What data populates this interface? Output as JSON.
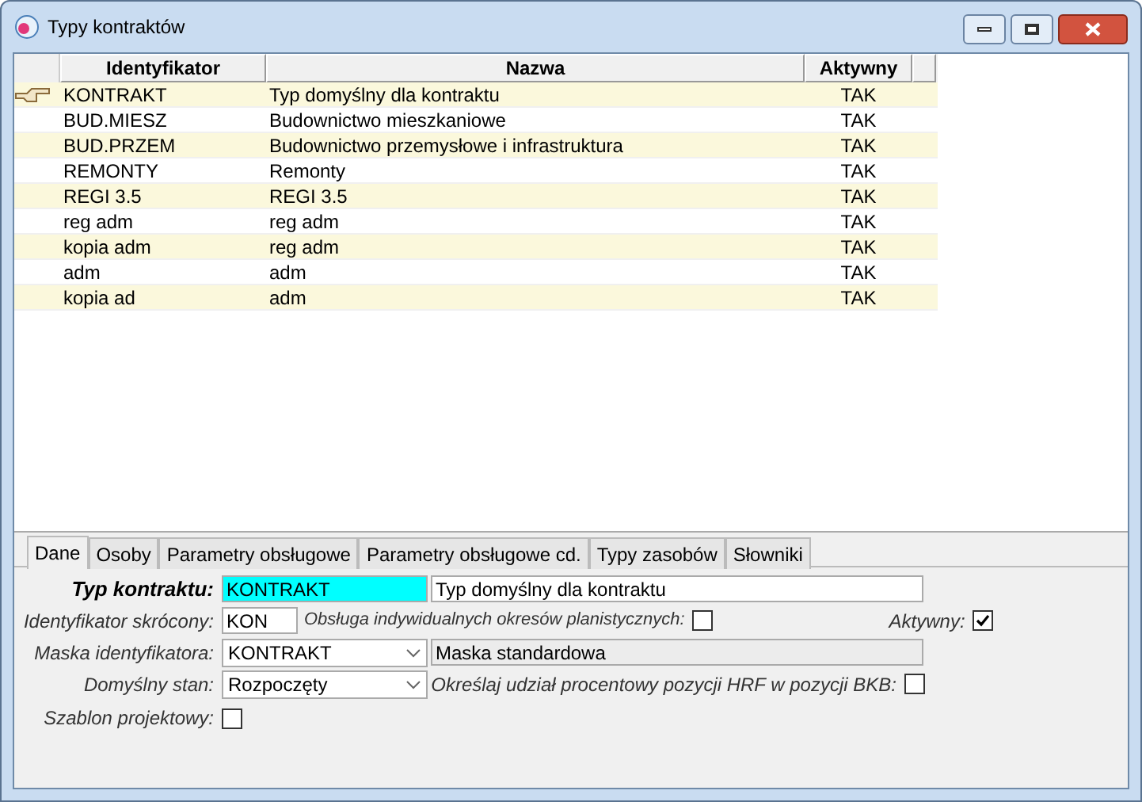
{
  "window": {
    "title": "Typy kontraktów"
  },
  "table": {
    "columns": [
      "Identyfikator",
      "Nazwa",
      "Aktywny"
    ],
    "rows": [
      {
        "id": "KONTRAKT",
        "name": "Typ domyślny dla kontraktu",
        "active": "TAK",
        "selected": true
      },
      {
        "id": "BUD.MIESZ",
        "name": "Budownictwo mieszkaniowe",
        "active": "TAK",
        "selected": false
      },
      {
        "id": "BUD.PRZEM",
        "name": "Budownictwo przemysłowe i infrastruktura",
        "active": "TAK",
        "selected": false
      },
      {
        "id": "REMONTY",
        "name": "Remonty",
        "active": "TAK",
        "selected": false
      },
      {
        "id": "REGI 3.5",
        "name": "REGI 3.5",
        "active": "TAK",
        "selected": false
      },
      {
        "id": "reg adm",
        "name": "reg adm",
        "active": "TAK",
        "selected": false
      },
      {
        "id": "kopia adm",
        "name": "reg adm",
        "active": "TAK",
        "selected": false
      },
      {
        "id": "adm",
        "name": "adm",
        "active": "TAK",
        "selected": false
      },
      {
        "id": "kopia ad",
        "name": "adm",
        "active": "TAK",
        "selected": false
      }
    ]
  },
  "tabs": [
    {
      "label": "Dane",
      "selected": true
    },
    {
      "label": "Osoby",
      "selected": false
    },
    {
      "label": "Parametry obsługowe",
      "selected": false
    },
    {
      "label": "Parametry obsługowe cd.",
      "selected": false
    },
    {
      "label": "Typy zasobów",
      "selected": false
    },
    {
      "label": "Słowniki",
      "selected": false
    }
  ],
  "form": {
    "type_label": "Typ kontraktu:",
    "type_value": "KONTRAKT",
    "type_desc": "Typ domyślny dla kontraktu",
    "short_label": "Identyfikator skrócony:",
    "short_value": "KON",
    "periods_label": "Obsługa indywidualnych okresów planistycznych:",
    "periods_checked": false,
    "active_label": "Aktywny:",
    "active_checked": true,
    "mask_label": "Maska identyfikatora:",
    "mask_value": "KONTRAKT",
    "mask_desc": "Maska standardowa",
    "state_label": "Domyślny stan:",
    "state_value": "Rozpoczęty",
    "hrf_label": "Określaj udział procentowy pozycji HRF w pozycji BKB:",
    "hrf_checked": false,
    "template_label": "Szablon projektowy:",
    "template_checked": false
  }
}
